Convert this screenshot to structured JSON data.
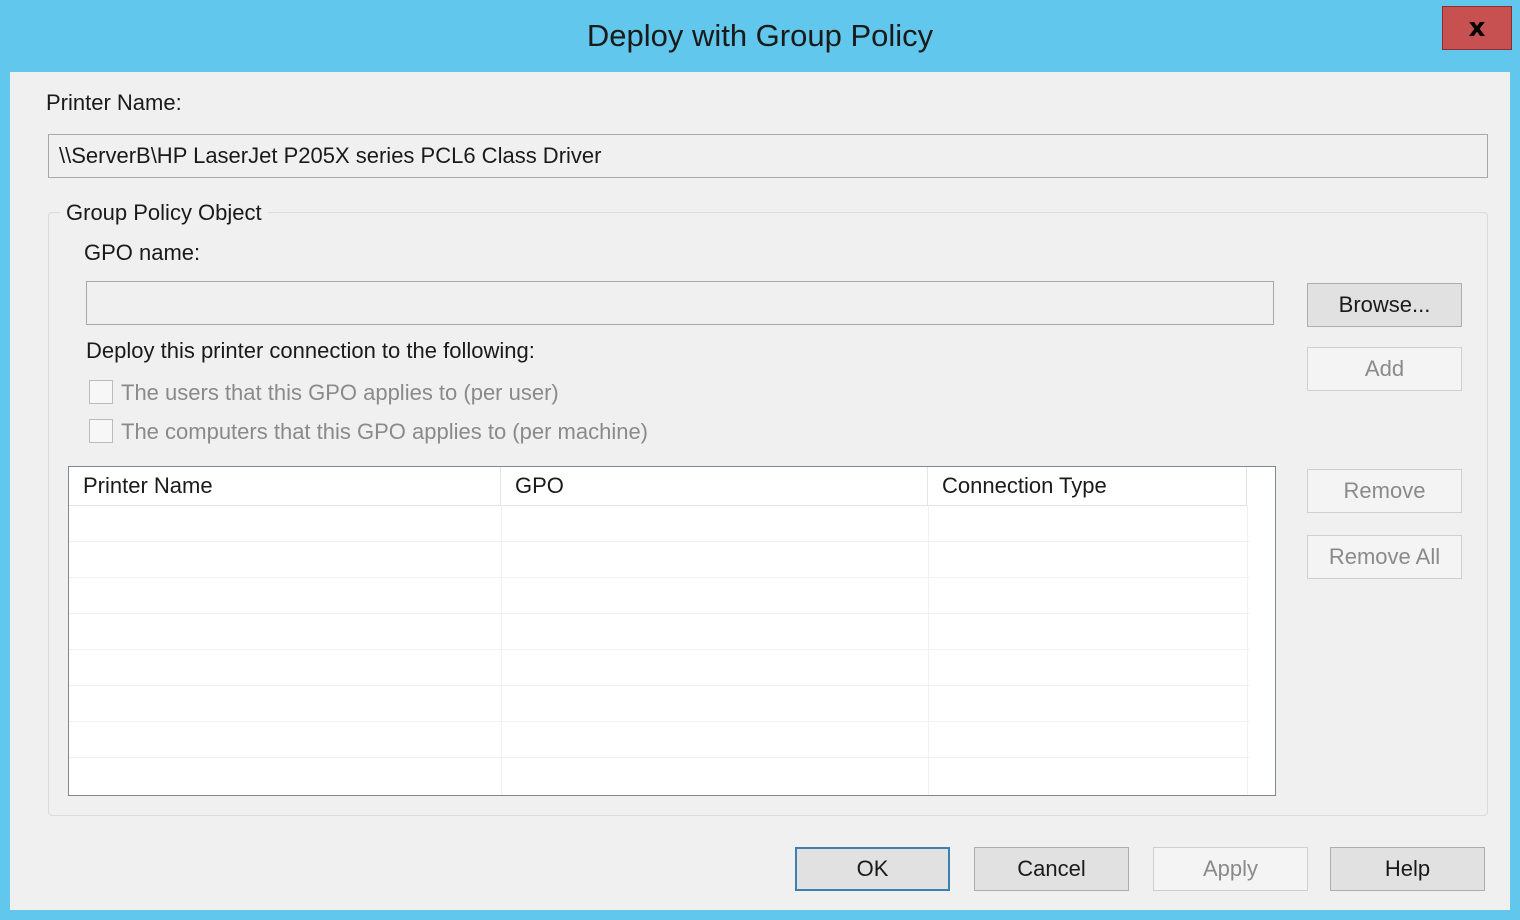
{
  "window": {
    "title": "Deploy with Group Policy",
    "close_glyph": "x"
  },
  "printer": {
    "label": "Printer Name:",
    "value": "\\\\ServerB\\HP LaserJet P205X series PCL6 Class Driver"
  },
  "group": {
    "legend": "Group Policy Object",
    "gpo_label": "GPO name:",
    "gpo_value": "",
    "deploy_label": "Deploy this printer connection to the following:",
    "options": [
      {
        "label": "The users that this GPO applies to (per user)",
        "checked": false
      },
      {
        "label": "The computers that this GPO applies to (per machine)",
        "checked": false
      }
    ],
    "buttons": {
      "browse": "Browse...",
      "add": "Add",
      "remove": "Remove",
      "remove_all": "Remove All"
    },
    "list": {
      "columns": [
        "Printer Name",
        "GPO",
        "Connection Type"
      ],
      "rows": []
    }
  },
  "footer": {
    "ok": "OK",
    "cancel": "Cancel",
    "apply": "Apply",
    "help": "Help"
  },
  "colors": {
    "title_bar": "#62c7ec",
    "close_button": "#c75050",
    "client_bg": "#f0f0f0"
  }
}
